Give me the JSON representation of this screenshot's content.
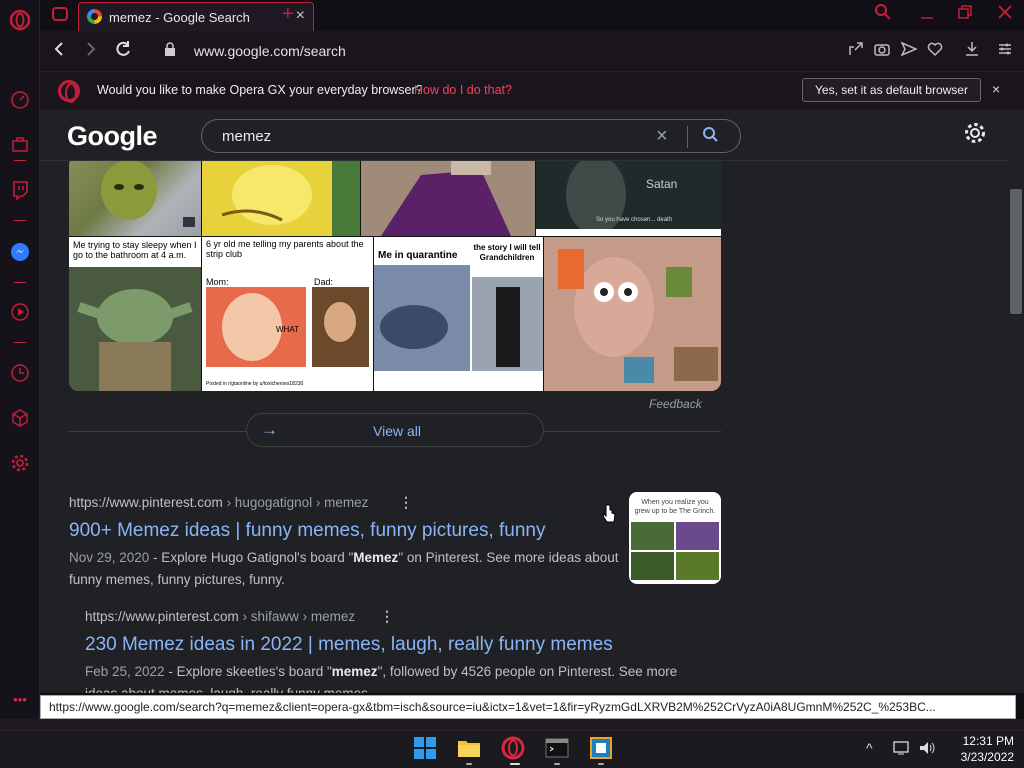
{
  "tab": {
    "title": "memez - Google Search",
    "close": "×",
    "new": "+"
  },
  "address": {
    "url": "www.google.com/search"
  },
  "banner": {
    "text": "Would you like to make Opera GX your everyday browser?",
    "link": "How do I do that?",
    "button": "Yes, set it as default browser",
    "close": "×"
  },
  "google": {
    "logo": "Google",
    "query": "memez"
  },
  "images": {
    "captions": {
      "satan": "Satan",
      "chosen": "So you have chosen... death",
      "sleepy": "Me trying to stay sleepy when I go to the bathroom at 4 a.m.",
      "strip": "6 yr old me telling my parents about the strip club",
      "mom": "Mom:",
      "dad": "Dad:",
      "what": "WHAT",
      "posted": "Posted in r/gtaonline by u/toxicheroes18230",
      "quarantine": "Me in quarantine",
      "story": "the story I will tell Grandchildren"
    },
    "feedback": "Feedback",
    "view_all": "View all"
  },
  "results": [
    {
      "site": "https://www.pinterest.com",
      "path": " › hugogatignol › memez",
      "title": "900+ Memez ideas | funny memes, funny pictures, funny",
      "date": "Nov 29, 2020",
      "snippet_a": " - Explore Hugo Gatignol's board \"",
      "snippet_em": "Memez",
      "snippet_b": "\" on Pinterest. See more ideas about funny memes, funny pictures, funny.",
      "thumb_caption": "When you realize you grew up to be The Grinch."
    },
    {
      "site": "https://www.pinterest.com",
      "path": " › shifaww › memez",
      "title": "230 Memez ideas in 2022 | memes, laugh, really funny memes",
      "date": "Feb 25, 2022",
      "snippet_a": " - Explore skeetles's board \"",
      "snippet_em": "memez",
      "snippet_b": "\", followed by 4526 people on Pinterest. See more ideas about memes, laugh, really funny memes."
    }
  ],
  "status_url": "https://www.google.com/search?q=memez&client=opera-gx&tbm=isch&source=iu&ictx=1&vet=1&fir=yRyzmGdLXRVB2M%252CrVyzA0iA8UGmnM%252C_%253BC...",
  "taskbar": {
    "time": "12:31 PM",
    "date": "3/23/2022"
  },
  "colors": {
    "accent": "#c21f3a",
    "link": "#8ab4f8",
    "banner_link": "#ff3c5b"
  }
}
